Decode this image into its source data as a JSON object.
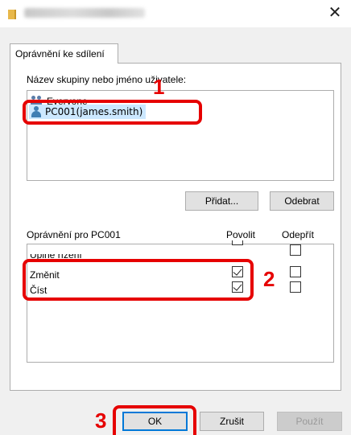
{
  "window": {
    "title": "",
    "close_icon": "close-icon"
  },
  "tab": {
    "label": "Oprávnění ke sdílení"
  },
  "users": {
    "label": "Název skupiny nebo jméno uživatele:",
    "items": [
      {
        "name": "Everyone",
        "icon": "group-icon"
      },
      {
        "name": "PC001(james.smith)",
        "icon": "user-icon",
        "selected": true
      }
    ],
    "add_label": "Přidat...",
    "remove_label": "Odebrat"
  },
  "permissions": {
    "label": "Oprávnění pro PC001",
    "allow_header": "Povolit",
    "deny_header": "Odepřít",
    "rows": [
      {
        "name": "Úplné řízení",
        "allow": false,
        "deny": false
      },
      {
        "name": "Změnit",
        "allow": true,
        "deny": false
      },
      {
        "name": "Číst",
        "allow": true,
        "deny": false
      }
    ]
  },
  "footer": {
    "ok_label": "OK",
    "cancel_label": "Zrušit",
    "apply_label": "Použít"
  },
  "annotations": {
    "color": "#e60000",
    "step1": "1",
    "step2": "2",
    "step3": "3"
  }
}
